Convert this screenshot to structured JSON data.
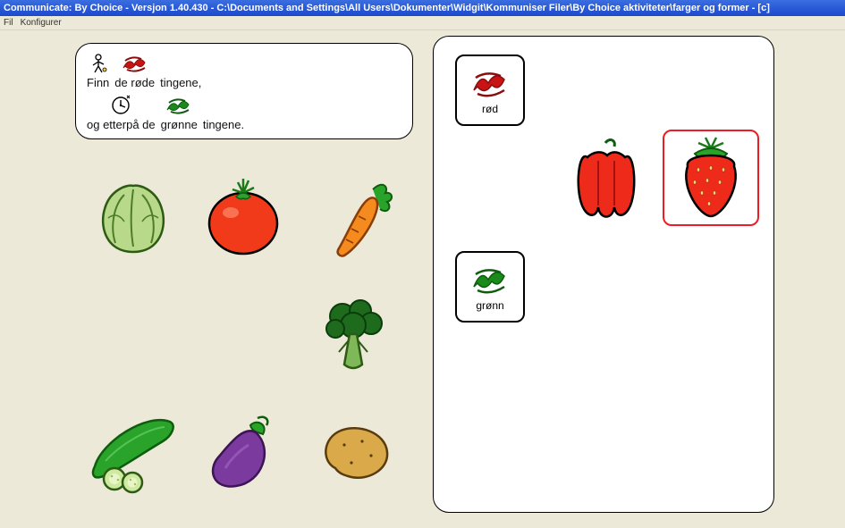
{
  "title": "Communicate: By Choice - Versjon 1.40.430 - C:\\Documents and Settings\\All Users\\Dokumenter\\Widgit\\Kommuniser Filer\\By Choice aktiviteter\\farger og former - [c]",
  "menu": {
    "file": "Fil",
    "config": "Konfigurer"
  },
  "instruction": {
    "row1": {
      "w1": "Finn",
      "w2": "de røde",
      "w3": "tingene,"
    },
    "row2": {
      "w1": "og etterpå de",
      "w2": "grønne",
      "w3": "tingene."
    }
  },
  "items": {
    "lettuce": "lettuce",
    "tomato": "tomato",
    "carrot": "carrot",
    "broccoli": "broccoli",
    "cucumber": "cucumber",
    "eggplant": "eggplant",
    "potato": "potato"
  },
  "categories": {
    "red": "rød",
    "green": "grønn"
  },
  "answers": {
    "pepper": "red pepper",
    "strawberry": "strawberry"
  },
  "colors": {
    "red": "#d11818",
    "green": "#1a8b1a",
    "selectBorder": "#ec1c24"
  }
}
